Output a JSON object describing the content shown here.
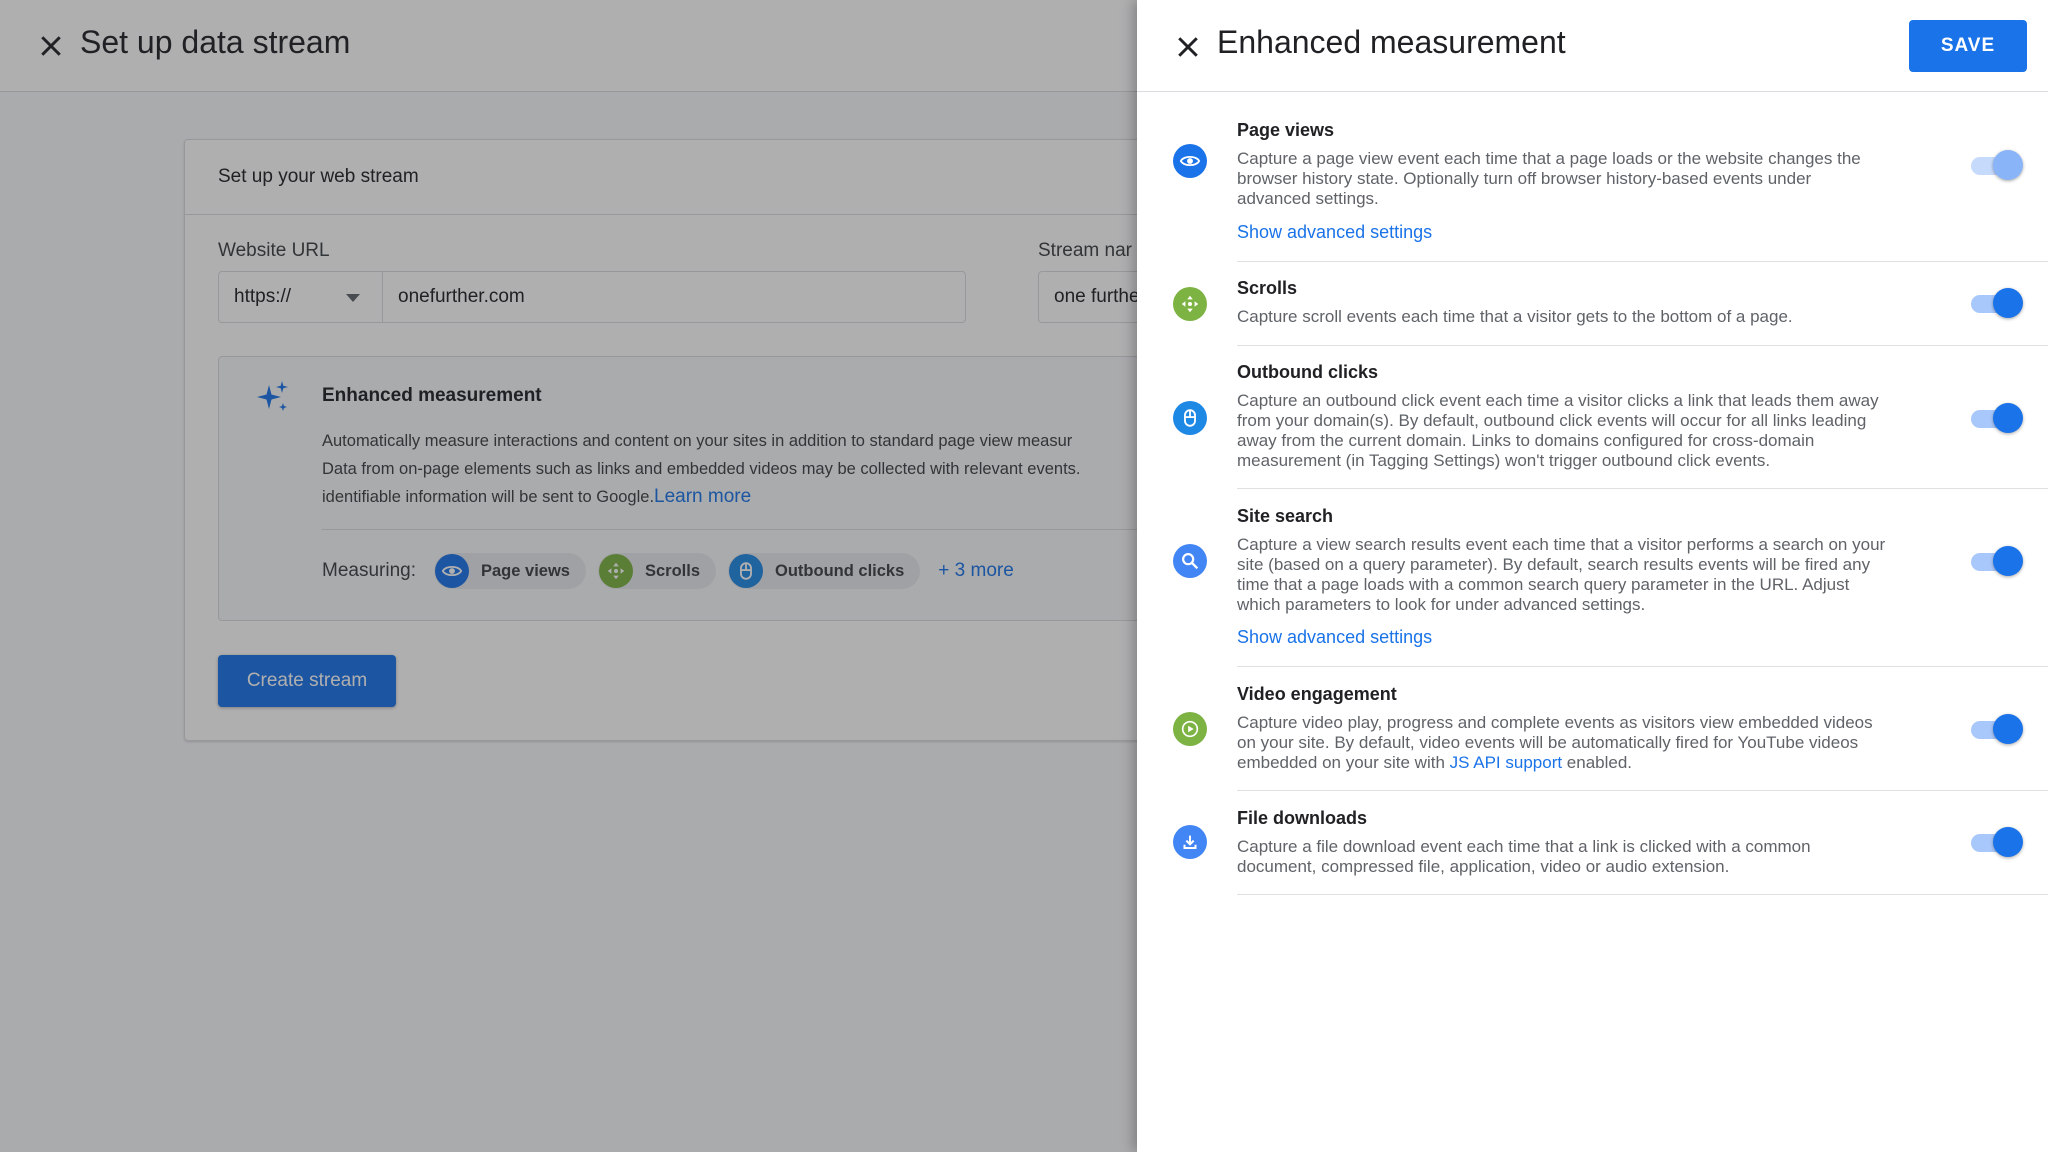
{
  "background": {
    "title": "Set up data stream",
    "card": {
      "heading": "Set up your web stream",
      "website_url_label": "Website URL",
      "protocol": "https://",
      "url_value": "onefurther.com",
      "stream_name_label": "Stream nar",
      "stream_name_value": "one furthe",
      "enhanced": {
        "title": "Enhanced measurement",
        "desc_line1": "Automatically measure interactions and content on your sites in addition to standard page view measur",
        "desc_line2": "Data from on-page elements such as links and embedded videos may be collected with relevant events.",
        "desc_line3": "identifiable information will be sent to Google.",
        "learn_more": "Learn more",
        "measuring_label": "Measuring:",
        "chips": [
          "Page views",
          "Scrolls",
          "Outbound clicks"
        ],
        "more": "+ 3 more"
      },
      "create_button": "Create stream"
    }
  },
  "panel": {
    "title": "Enhanced measurement",
    "save_label": "SAVE",
    "settings": [
      {
        "title": "Page views",
        "desc": [
          "Capture a page view event each time that a page loads or the website changes the",
          "browser history state. Optionally turn off browser history-based events under",
          "advanced settings."
        ],
        "link": "Show advanced settings",
        "enabled": true,
        "icon": "eye-icon"
      },
      {
        "title": "Scrolls",
        "desc": [
          "Capture scroll events each time that a visitor gets to the bottom of a page."
        ],
        "enabled": true,
        "icon": "scroll-icon"
      },
      {
        "title": "Outbound clicks",
        "desc": [
          "Capture an outbound click event each time a visitor clicks a link that leads them away",
          "from your domain(s). By default, outbound click events will occur for all links leading",
          "away from the current domain. Links to domains configured for cross-domain",
          "measurement (in Tagging Settings) won't trigger outbound click events."
        ],
        "enabled": true,
        "icon": "mouse-icon"
      },
      {
        "title": "Site search",
        "desc": [
          "Capture a view search results event each time that a visitor performs a search on your",
          "site (based on a query parameter). By default, search results events will be fired any",
          "time that a page loads with a common search query parameter in the URL. Adjust",
          "which parameters to look for under advanced settings."
        ],
        "link": "Show advanced settings",
        "enabled": true,
        "icon": "search-icon"
      },
      {
        "title": "Video engagement",
        "desc": [
          "Capture video play, progress and complete events as visitors view embedded videos",
          "on your site. By default, video events will be automatically fired for YouTube videos"
        ],
        "desc_last_prefix": "embedded on your site with ",
        "desc_last_link": "JS API support",
        "desc_last_suffix": " enabled.",
        "enabled": true,
        "icon": "play-icon"
      },
      {
        "title": "File downloads",
        "desc": [
          "Capture a file download event each time that a link is clicked with a common",
          "document, compressed file, application, video or audio extension."
        ],
        "enabled": true,
        "icon": "download-icon"
      }
    ]
  },
  "colors": {
    "primary": "#1a73e8",
    "page_views_icon": "#1a73e8",
    "scrolls_icon": "#7cb342",
    "outbound_icon": "#1e88e5",
    "search_icon": "#4285f4",
    "video_icon": "#7cb342",
    "download_icon": "#4285f4"
  }
}
